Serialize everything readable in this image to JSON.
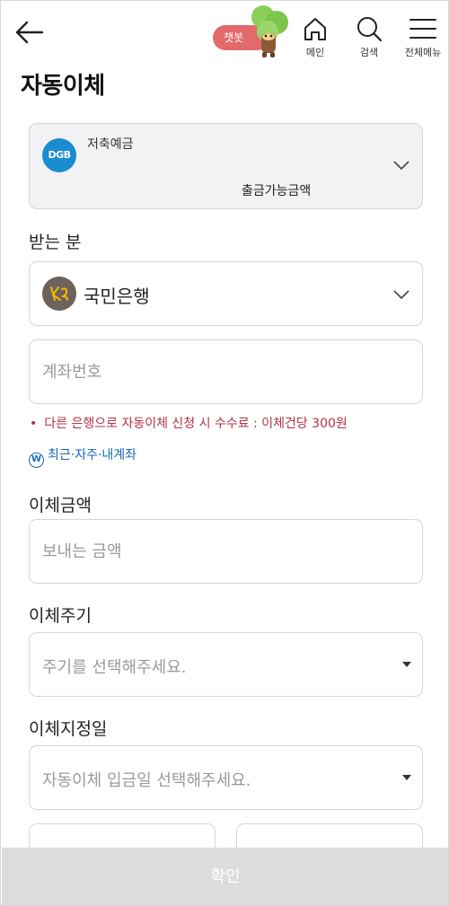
{
  "header": {
    "chatbot_label": "챗봇",
    "nav": [
      {
        "label": "메인",
        "icon": "home-icon"
      },
      {
        "label": "검색",
        "icon": "search-icon"
      },
      {
        "label": "전체메뉴",
        "icon": "menu-icon"
      }
    ]
  },
  "page_title": "자동이체",
  "account": {
    "logo_text": "DGB",
    "name": "저축예금",
    "available_label": "출금가능금액"
  },
  "recipient": {
    "section_label": "받는 분",
    "bank_name": "국민은행",
    "account_placeholder": "계좌번호",
    "fee_note": "다른 은행으로 자동이체 신청 시 수수료 : 이체건당 300원",
    "recent_link": "최근·자주·내계좌",
    "recent_icon_text": "W"
  },
  "amount": {
    "section_label": "이체금액",
    "placeholder": "보내는 금액"
  },
  "cycle": {
    "section_label": "이체주기",
    "placeholder": "주기를 선택해주세요."
  },
  "date": {
    "section_label": "이체지정일",
    "placeholder": "자동이체 입금일 선택해주세요."
  },
  "confirm_label": "확인",
  "colors": {
    "chatbot": "#e26a6a",
    "fee_note": "#b03347",
    "link": "#1a67b8",
    "dgb_logo": "#1b8ccf",
    "confirm_disabled": "#dcdcdc"
  }
}
